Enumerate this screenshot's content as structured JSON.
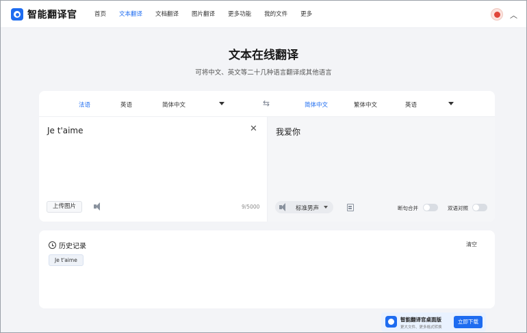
{
  "app": {
    "name": "智能翻译官"
  },
  "nav": {
    "items": [
      {
        "label": "首页",
        "active": false
      },
      {
        "label": "文本翻译",
        "active": true
      },
      {
        "label": "文档翻译",
        "active": false
      },
      {
        "label": "图片翻译",
        "active": false
      },
      {
        "label": "更多功能",
        "active": false
      },
      {
        "label": "我的文件",
        "active": false
      },
      {
        "label": "更多",
        "active": false
      }
    ]
  },
  "header": {
    "title": "文本在线翻译",
    "subtitle": "可将中文、英文等二十几种语言翻译成其他语言"
  },
  "source_langs": [
    "法语",
    "英语",
    "简体中文"
  ],
  "target_langs": [
    "简体中文",
    "繁体中文",
    "英语"
  ],
  "source": {
    "text": "Je t'aime",
    "upload_label": "上传图片",
    "char_count": "9/5000"
  },
  "target": {
    "text": "我爱你",
    "voice_label": "标准男声",
    "toggle_merge_label": "断句合并",
    "toggle_merge_on": false,
    "toggle_bilingual_label": "双语对照",
    "toggle_bilingual_on": false
  },
  "history": {
    "title": "历史记录",
    "clear_label": "清空",
    "items": [
      "Je t'aime"
    ]
  },
  "promo": {
    "title": "智能翻译官桌面版",
    "subtitle": "更大文件、更多格式转换",
    "button": "立即下载"
  },
  "colors": {
    "accent": "#1e6cf0",
    "page_bg": "#f3f4f7"
  }
}
